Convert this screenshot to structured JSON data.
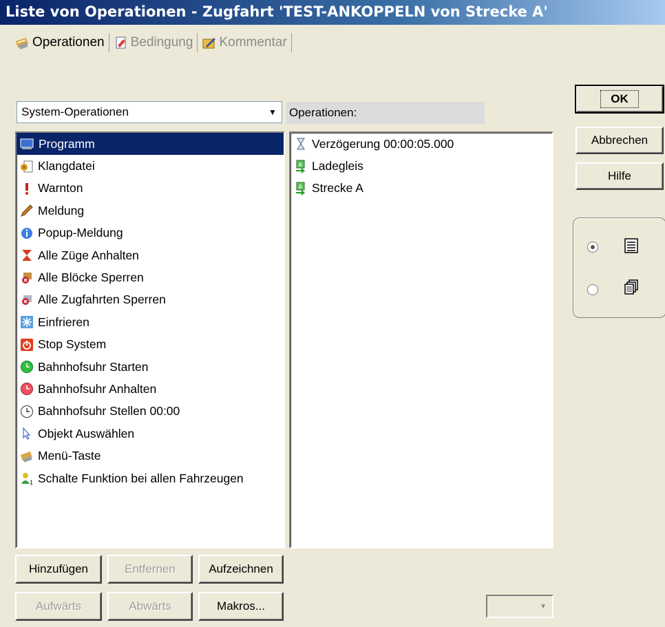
{
  "window": {
    "title": "Liste von Operationen - Zugfahrt 'TEST-ANKOPPELN von Strecke A'"
  },
  "tabs": [
    {
      "label": "Operationen",
      "active": true,
      "icon": "menu-key-icon"
    },
    {
      "label": "Bedingung",
      "active": false,
      "icon": "condition-icon"
    },
    {
      "label": "Kommentar",
      "active": false,
      "icon": "comment-icon"
    }
  ],
  "category_select": {
    "value": "System-Operationen"
  },
  "operations_label": "Operationen:",
  "system_operations": [
    {
      "label": "Programm",
      "icon": "program-icon",
      "selected": true
    },
    {
      "label": "Klangdatei",
      "icon": "sound-file-icon"
    },
    {
      "label": "Warnton",
      "icon": "warning-tone-icon"
    },
    {
      "label": "Meldung",
      "icon": "message-pencil-icon"
    },
    {
      "label": "Popup-Meldung",
      "icon": "info-icon"
    },
    {
      "label": "Alle Züge Anhalten",
      "icon": "hourglass-stop-icon"
    },
    {
      "label": "Alle Blöcke Sperren",
      "icon": "lock-blocks-icon"
    },
    {
      "label": "Alle Zugfahrten Sperren",
      "icon": "lock-routes-icon"
    },
    {
      "label": "Einfrieren",
      "icon": "snowflake-icon"
    },
    {
      "label": "Stop System",
      "icon": "power-icon"
    },
    {
      "label": "Bahnhofsuhr Starten",
      "icon": "clock-start-icon"
    },
    {
      "label": "Bahnhofsuhr Anhalten",
      "icon": "clock-stop-icon"
    },
    {
      "label": "Bahnhofsuhr Stellen 00:00",
      "icon": "clock-set-icon"
    },
    {
      "label": "Objekt Auswählen",
      "icon": "cursor-icon"
    },
    {
      "label": "Menü-Taste",
      "icon": "menu-key-icon"
    },
    {
      "label": "Schalte Funktion bei allen Fahrzeugen",
      "icon": "function-switch-icon"
    }
  ],
  "operations": [
    {
      "label": "Verzögerung 00:00:05.000",
      "icon": "hourglass-icon"
    },
    {
      "label": "Ladegleis",
      "icon": "route-icon"
    },
    {
      "label": "Strecke A",
      "icon": "route-icon"
    }
  ],
  "buttons": {
    "ok": "OK",
    "cancel": "Abbrechen",
    "help": "Hilfe",
    "add": "Hinzufügen",
    "remove": "Entfernen",
    "record": "Aufzeichnen",
    "up": "Aufwärts",
    "down": "Abwärts",
    "macros": "Makros..."
  }
}
